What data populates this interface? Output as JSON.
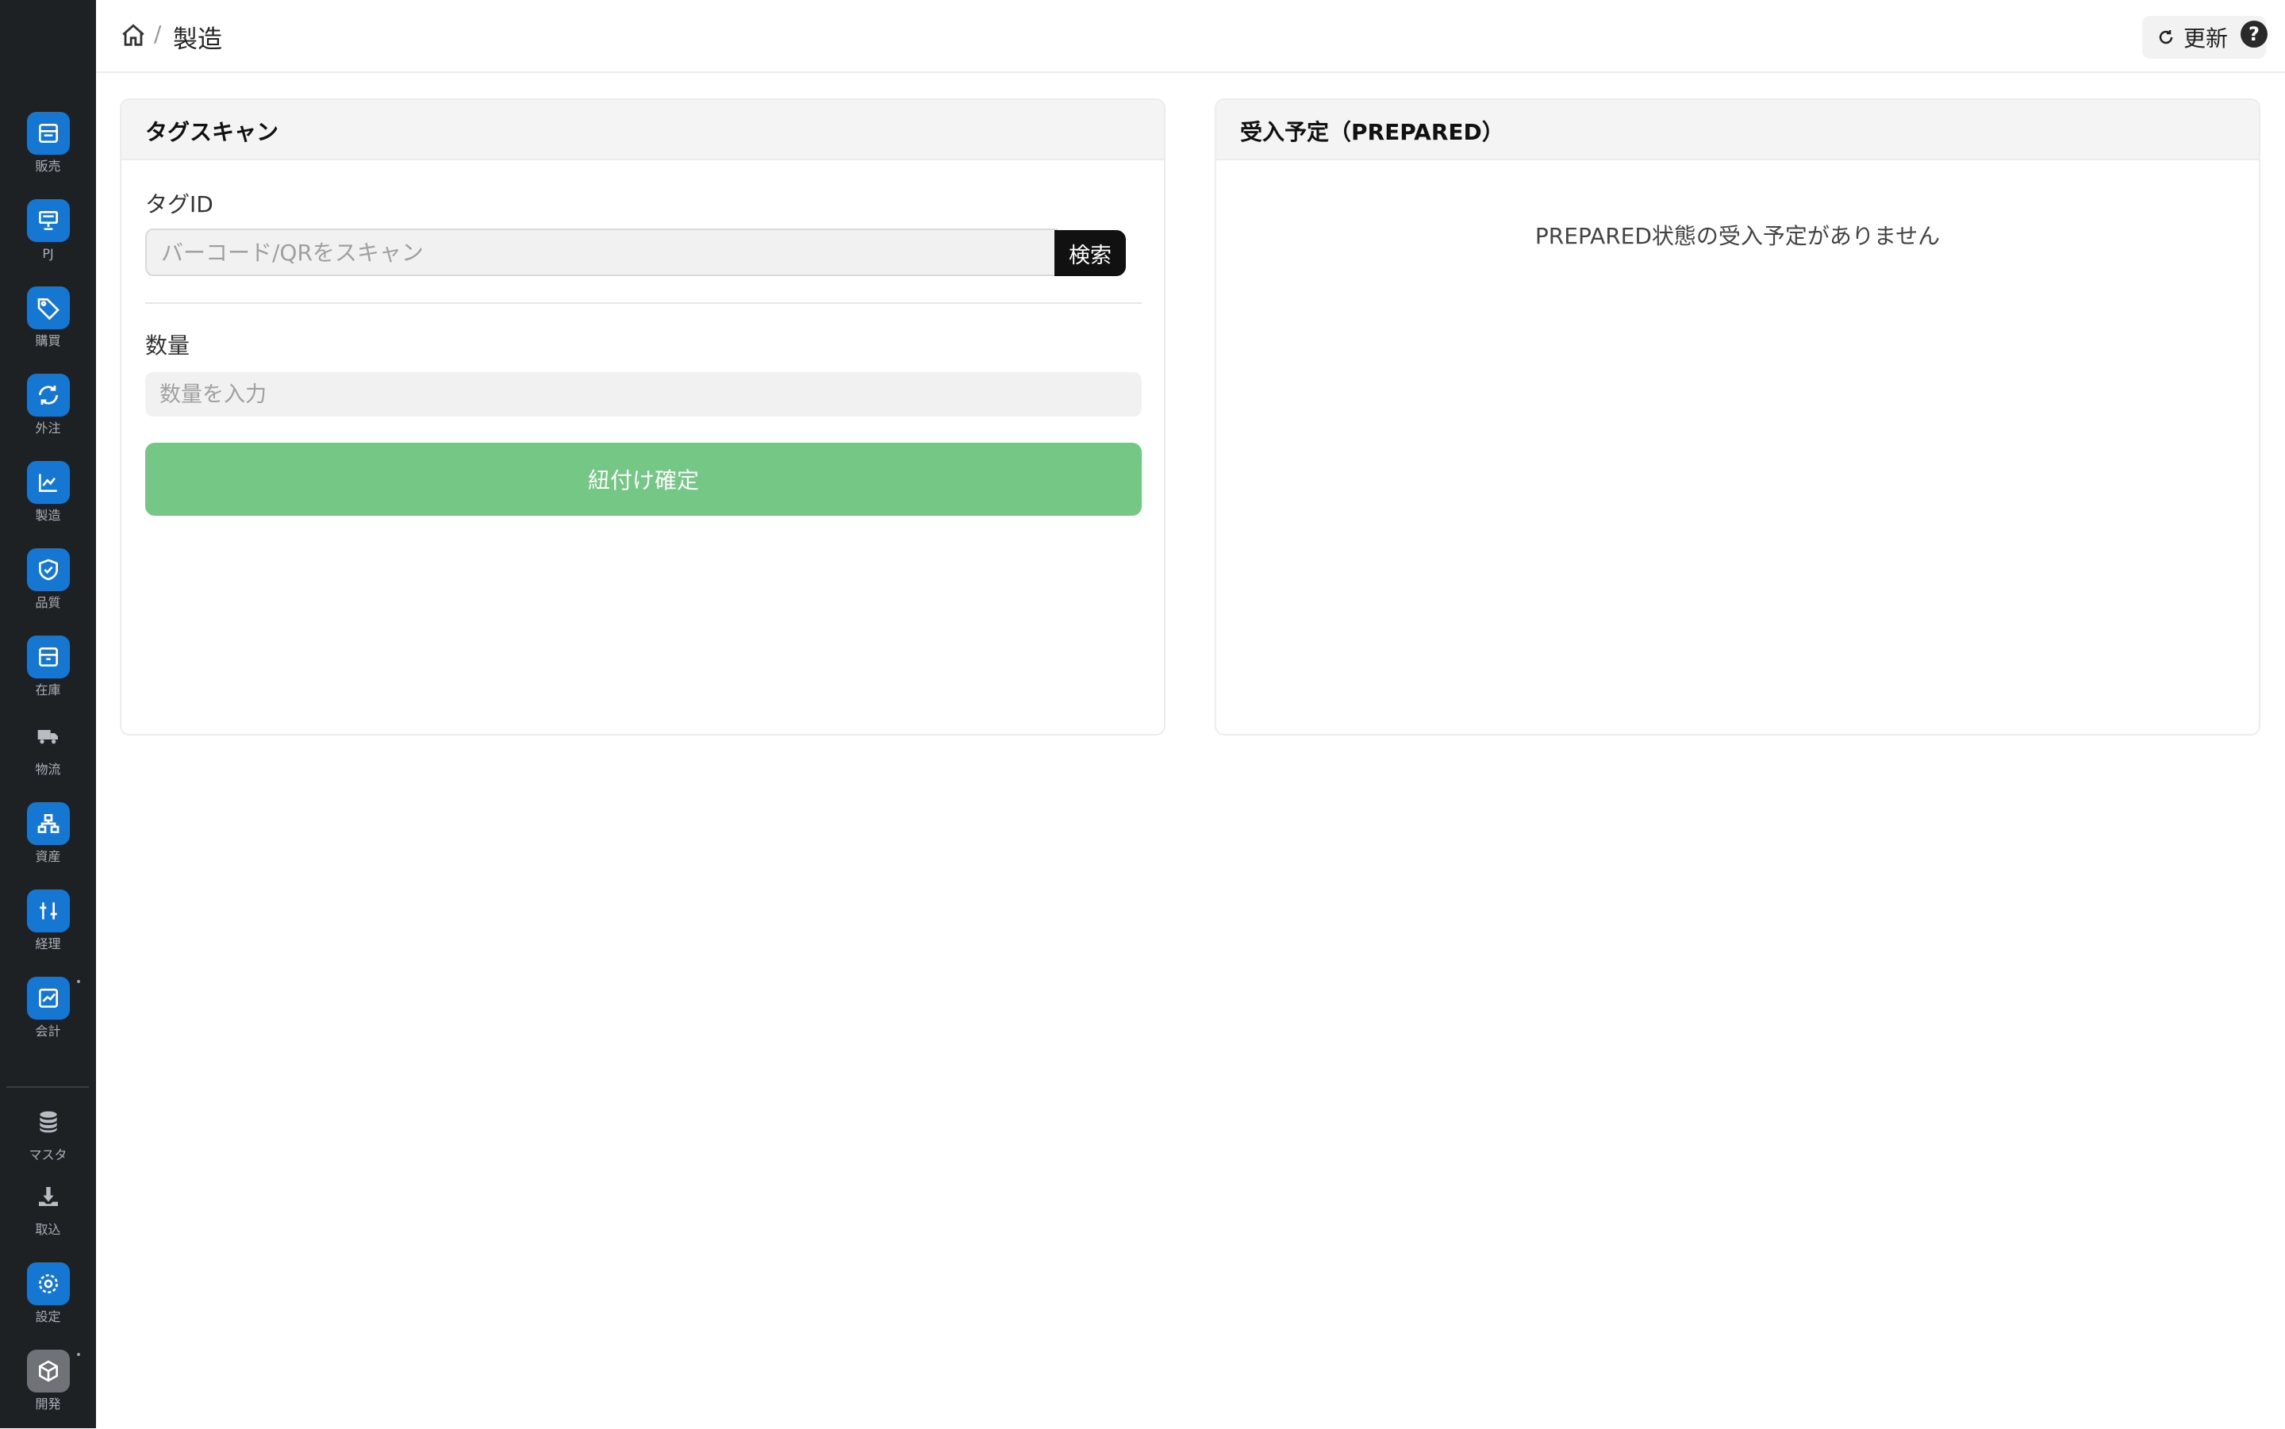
{
  "sidebar": {
    "items": [
      {
        "label": "販売",
        "icon": "storefront-icon"
      },
      {
        "label": "PJ",
        "icon": "presentation-icon"
      },
      {
        "label": "購買",
        "icon": "tag-icon"
      },
      {
        "label": "外注",
        "icon": "refresh-icon"
      },
      {
        "label": "製造",
        "icon": "chart-icon"
      },
      {
        "label": "品質",
        "icon": "shield-check-icon"
      },
      {
        "label": "在庫",
        "icon": "box-icon"
      },
      {
        "label": "物流",
        "icon": "truck-icon"
      },
      {
        "label": "資産",
        "icon": "hierarchy-icon"
      },
      {
        "label": "経理",
        "icon": "sliders-icon"
      },
      {
        "label": "会計",
        "icon": "ledger-chart-icon"
      },
      {
        "label": "マスタ",
        "icon": "database-icon"
      },
      {
        "label": "取込",
        "icon": "download-icon"
      },
      {
        "label": "設定",
        "icon": "gear-icon"
      },
      {
        "label": "開発",
        "icon": "cube-icon"
      }
    ]
  },
  "header": {
    "breadcrumb_separator": "/",
    "breadcrumb_current": "製造",
    "refresh_label": "更新",
    "help_glyph": "?"
  },
  "tag_scan": {
    "title": "タグスキャン",
    "tag_id_label": "タグID",
    "tag_id_placeholder": "バーコード/QRをスキャン",
    "tag_id_value": "",
    "search_label": "検索",
    "quantity_label": "数量",
    "quantity_placeholder": "数量を入力",
    "quantity_value": "",
    "confirm_label": "紐付け確定"
  },
  "prepared": {
    "title": "受入予定（PREPARED）",
    "empty_message": "PREPARED状態の受入予定がありません"
  },
  "colors": {
    "sidebar_bg": "#1e2124",
    "nav_icon_bg": "#1677d2",
    "confirm_button": "#74c785",
    "search_button": "#111111"
  }
}
